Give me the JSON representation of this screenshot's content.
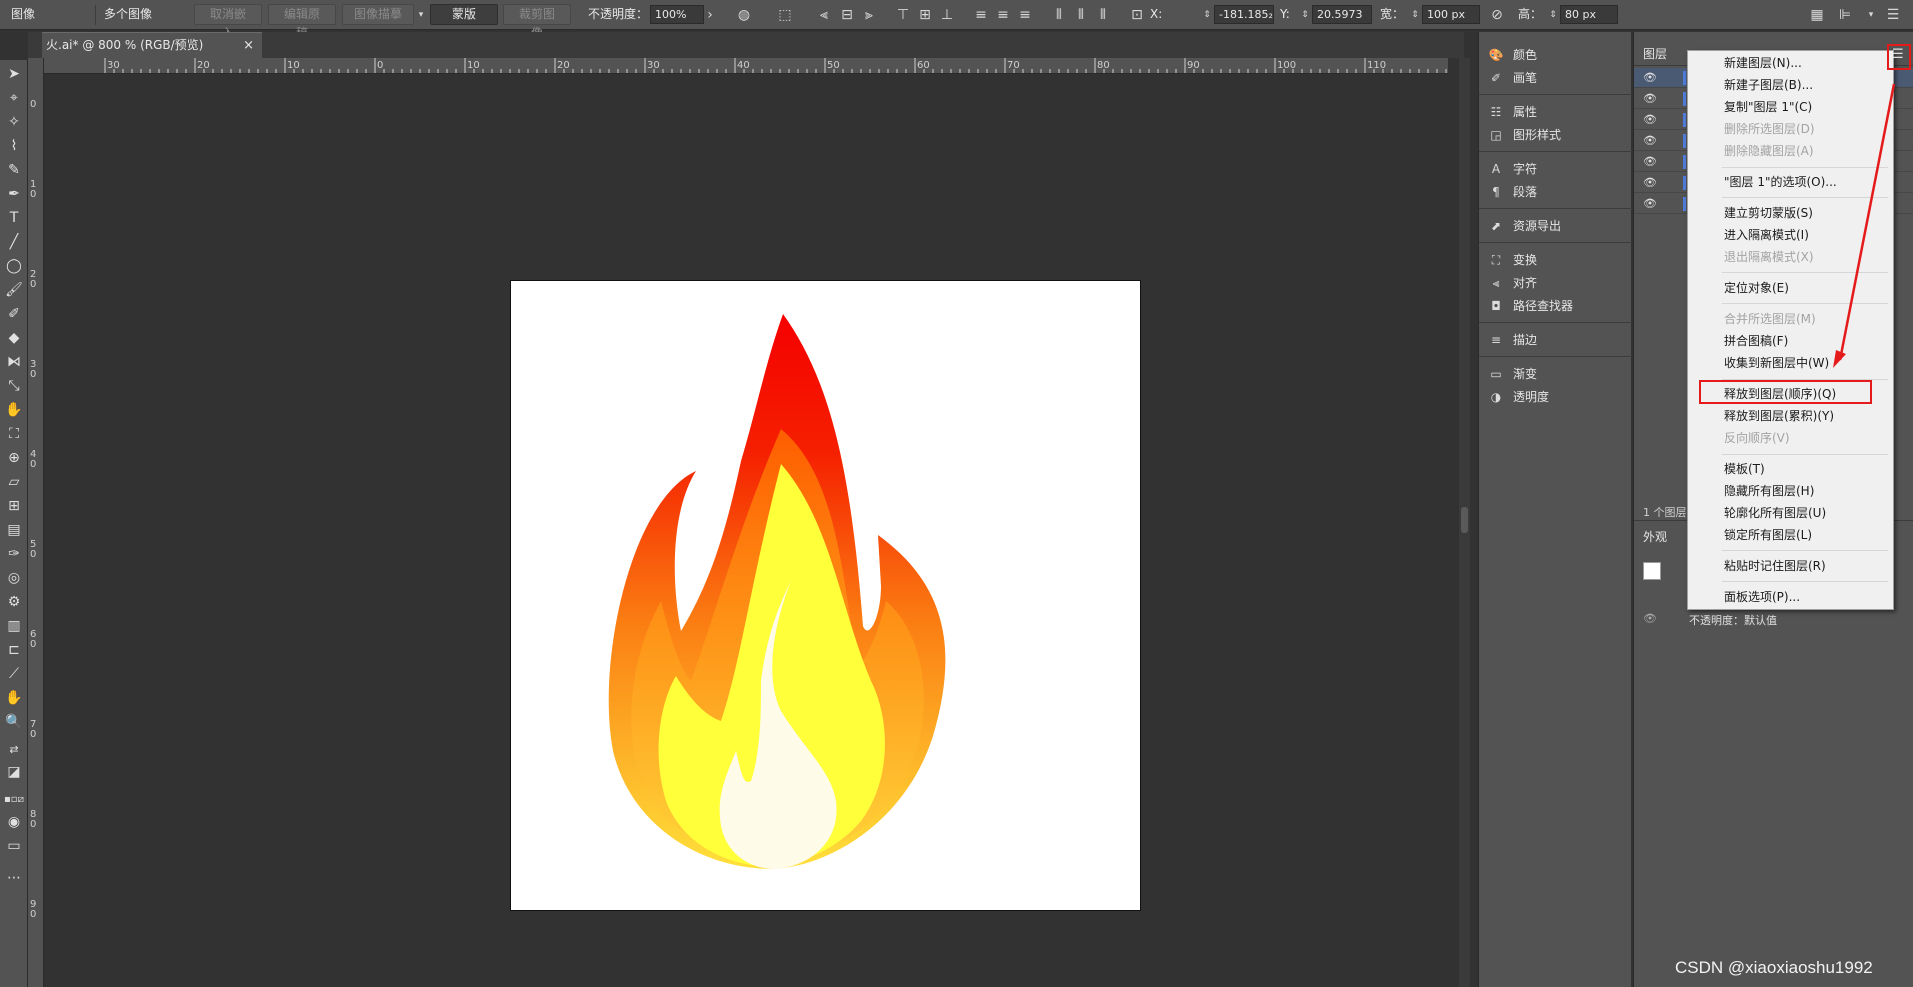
{
  "control_bar": {
    "object_type": "图像",
    "multi_images": "多个图像",
    "unembed_btn": "取消嵌入",
    "edit_original_btn": "编辑原稿",
    "image_trace_btn": "图像描摹",
    "mask_btn": "蒙版",
    "crop_image_btn": "裁剪图像",
    "opacity_label": "不透明度：",
    "opacity_value": "100%",
    "x_label": "X:",
    "x_value": "-181.185₂",
    "y_label": "Y:",
    "y_value": "20.5973",
    "w_label": "宽：",
    "w_value": "100 px",
    "h_label": "高：",
    "h_value": "80 px"
  },
  "document_tab": {
    "title": "火.ai* @ 800 % (RGB/预览)",
    "close": "×"
  },
  "ruler_top": [
    "30",
    "20",
    "10",
    "0",
    "10",
    "20",
    "30",
    "40",
    "50",
    "60",
    "70",
    "80",
    "90",
    "100",
    "110"
  ],
  "ruler_left": [
    "0",
    "1 0",
    "2 0",
    "3 0",
    "4 0",
    "5 0",
    "6 0",
    "7 0",
    "8 0",
    "9 0"
  ],
  "dock": {
    "items": [
      {
        "label": "颜色",
        "icon": "palette-icon"
      },
      {
        "label": "画笔",
        "icon": "brush-icon"
      },
      {
        "label": "属性",
        "icon": "properties-icon"
      },
      {
        "label": "图形样式",
        "icon": "graphic-styles-icon"
      },
      {
        "label": "字符",
        "icon": "character-icon"
      },
      {
        "label": "段落",
        "icon": "paragraph-icon"
      },
      {
        "label": "资源导出",
        "icon": "asset-export-icon"
      },
      {
        "label": "变换",
        "icon": "transform-icon"
      },
      {
        "label": "对齐",
        "icon": "align-icon"
      },
      {
        "label": "路径查找器",
        "icon": "pathfinder-icon"
      },
      {
        "label": "描边",
        "icon": "stroke-icon"
      },
      {
        "label": "渐变",
        "icon": "gradient-icon"
      },
      {
        "label": "透明度",
        "icon": "transparency-icon"
      }
    ]
  },
  "layers_panel": {
    "title": "图层",
    "count_label": "1 个图层",
    "appearance_title": "外观",
    "appearance_opacity": "不透明度：默认值"
  },
  "context_menu": {
    "items": [
      {
        "label": "新建图层(N)...",
        "disabled": false
      },
      {
        "label": "新建子图层(B)...",
        "disabled": false
      },
      {
        "label": "复制\"图层 1\"(C)",
        "disabled": false
      },
      {
        "label": "删除所选图层(D)",
        "disabled": true
      },
      {
        "label": "删除隐藏图层(A)",
        "disabled": true
      },
      {
        "label": "\"图层 1\"的选项(O)...",
        "disabled": false
      },
      {
        "label": "建立剪切蒙版(S)",
        "disabled": false
      },
      {
        "label": "进入隔离模式(I)",
        "disabled": false
      },
      {
        "label": "退出隔离模式(X)",
        "disabled": true
      },
      {
        "label": "定位对象(E)",
        "disabled": false
      },
      {
        "label": "合并所选图层(M)",
        "disabled": true
      },
      {
        "label": "拼合图稿(F)",
        "disabled": false
      },
      {
        "label": "收集到新图层中(W)",
        "disabled": false
      },
      {
        "label": "释放到图层(顺序)(Q)",
        "disabled": false
      },
      {
        "label": "释放到图层(累积)(Y)",
        "disabled": false
      },
      {
        "label": "反向顺序(V)",
        "disabled": true
      },
      {
        "label": "模板(T)",
        "disabled": false
      },
      {
        "label": "隐藏所有图层(H)",
        "disabled": false
      },
      {
        "label": "轮廓化所有图层(U)",
        "disabled": false
      },
      {
        "label": "锁定所有图层(L)",
        "disabled": false
      },
      {
        "label": "粘贴时记住图层(R)",
        "disabled": false
      },
      {
        "label": "面板选项(P)...",
        "disabled": false
      }
    ]
  },
  "watermark": "CSDN @xiaoxiaoshu1992",
  "colors": {
    "accent_red": "#e51a1a",
    "layer_color": "#4f7bd9",
    "flame_outer_top": "#f50000",
    "flame_outer_bottom": "#ffd83a",
    "flame_middle": "#ffff3a",
    "flame_inner": "#fefbe8"
  }
}
